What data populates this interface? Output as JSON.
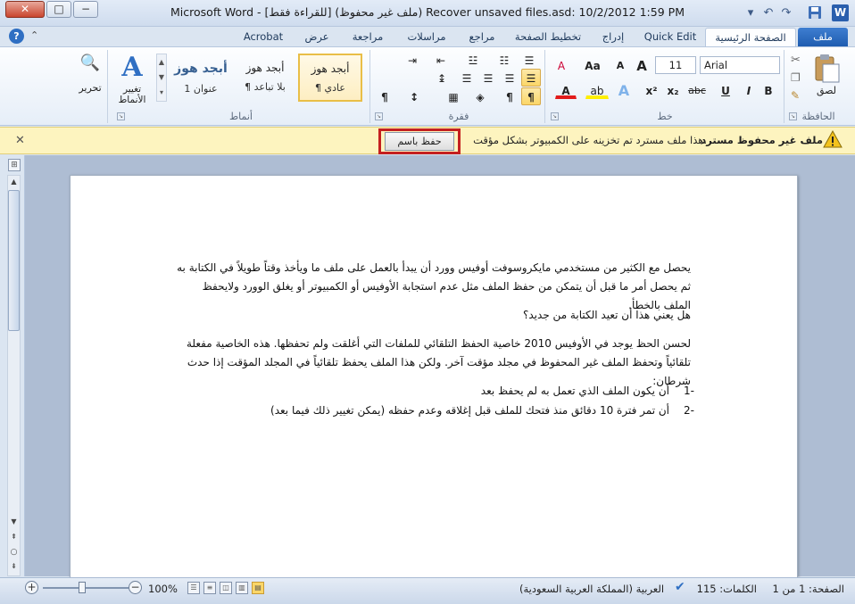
{
  "window": {
    "title": "Microsoft Word  -  [للقراءة فقط] (ملف غير محفوظ) Recover unsaved files.asd: 10/2/2012 1:59 PM",
    "close_glyph": "✕",
    "max_glyph": "□",
    "min_glyph": "−"
  },
  "qat": {
    "save_glyph": "💾",
    "undo_glyph": "↶",
    "redo_glyph": "↷",
    "customize_glyph": "▾",
    "word_letter": "W"
  },
  "tabs": {
    "file": "ملف",
    "home": "الصفحة الرئيسية",
    "quick_edit": "Quick Edit",
    "insert": "إدراج",
    "page_layout": "تخطيط الصفحة",
    "references": "مراجع",
    "mailings": "مراسلات",
    "review": "مراجعة",
    "view": "عرض",
    "acrobat": "Acrobat"
  },
  "ribbon": {
    "groups": {
      "clipboard": "الحافظة",
      "font": "خط",
      "paragraph": "فقرة",
      "styles": "أنماط"
    },
    "clipboard": {
      "paste_label": "لصق"
    },
    "font": {
      "font_name": "Arial",
      "font_size": "11"
    },
    "styles": {
      "items": [
        {
          "sample": "أبجد هوز",
          "name": "¶ عادي"
        },
        {
          "sample": "أبجد هوز",
          "name": "¶ بلا تباعد"
        },
        {
          "sample": "أبجد هوز",
          "name": "عنوان 1"
        }
      ],
      "change_styles": "تغيير الأنماط",
      "editing": "تحرير"
    },
    "buttons": {
      "bold": "B",
      "italic": "I",
      "underline": "U",
      "strike": "abc",
      "subscript": "x₂",
      "superscript": "x²",
      "grow": "A",
      "shrink": "A",
      "case": "Aa",
      "clear": "A",
      "text_effect": "A",
      "highlight": "ab",
      "font_color": "A",
      "pilcrow": "¶",
      "sort": "↕",
      "ltr": "¶",
      "rtl": "¶"
    }
  },
  "infobar": {
    "title": "ملف غير محفوظ مسترد",
    "message": "هذا ملف مسترد تم تخزينه على الكمبيوتر بشكل مؤقت.",
    "button": "حفظ باسم",
    "close": "✕"
  },
  "document": {
    "paragraph1": "يحصل مع الكثير من مستخدمي مايكروسوفت أوفيس وورد أن يبدأ بالعمل على ملف ما ويأخذ وقتاً طويلاً في الكتابة به ثم يحصل أمر ما قبل أن يتمكن من حفظ الملف مثل عدم استجابة الأوفيس أو الكمبيوتر أو يغلق الوورد ولايحفظ الملف بالخطأ.",
    "paragraph2": "هل يعني هذا أن تعيد الكتابة من جديد؟",
    "paragraph3": "لحسن الحظ يوجد في الأوفيس 2010  خاصية الحفظ التلقائي للملفات التي أغلقت ولم تحفظها.  هذه الخاصية مفعلة تلقائياً وتحفظ الملف غير المحفوظ في مجلد مؤقت آخر.   ولكن هذا الملف يحفظ تلقائياً في المجلد المؤقت إذا حدث شرطان:",
    "list": [
      {
        "num": "1-",
        "text": "أن يكون الملف الذي تعمل به لم يحفظ بعد"
      },
      {
        "num": "2-",
        "text": "أن تمر فترة 10 دقائق منذ فتحك للملف قبل إغلاقه وعدم حفظه (يمكن تغيير ذلك فيما بعد)"
      }
    ]
  },
  "status": {
    "page": "الصفحة: 1 من 1",
    "words": "الكلمات: 115",
    "language": "العربية (المملكة العربية السعودية)",
    "zoom": "100%",
    "zoom_minus": "−",
    "zoom_plus": "+"
  },
  "icons": {
    "warning": "warning-icon",
    "help": "help-icon",
    "paste": "paste-icon"
  },
  "colors": {
    "accent": "#2a5fad",
    "infobar": "#fdf4bf",
    "highlight_box": "#c42020"
  }
}
